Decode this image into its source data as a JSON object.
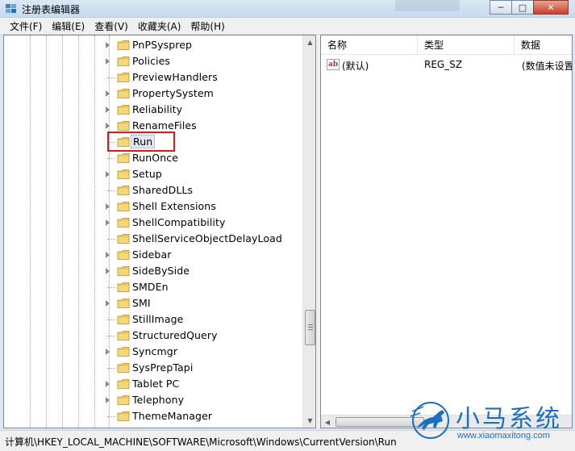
{
  "window": {
    "title": "注册表编辑器",
    "min_label": "─",
    "max_label": "□",
    "close_label": "✕"
  },
  "menu": [
    "文件(F)",
    "编辑(E)",
    "查看(V)",
    "收藏夹(A)",
    "帮助(H)"
  ],
  "tree": {
    "items": [
      {
        "label": "PnPSysprep",
        "expandable": true
      },
      {
        "label": "Policies",
        "expandable": true
      },
      {
        "label": "PreviewHandlers",
        "expandable": false
      },
      {
        "label": "PropertySystem",
        "expandable": true
      },
      {
        "label": "Reliability",
        "expandable": true
      },
      {
        "label": "RenameFiles",
        "expandable": true
      },
      {
        "label": "Run",
        "expandable": false,
        "selected": true
      },
      {
        "label": "RunOnce",
        "expandable": false
      },
      {
        "label": "Setup",
        "expandable": true
      },
      {
        "label": "SharedDLLs",
        "expandable": false
      },
      {
        "label": "Shell Extensions",
        "expandable": true
      },
      {
        "label": "ShellCompatibility",
        "expandable": true
      },
      {
        "label": "ShellServiceObjectDelayLoad",
        "expandable": false
      },
      {
        "label": "Sidebar",
        "expandable": true
      },
      {
        "label": "SideBySide",
        "expandable": true
      },
      {
        "label": "SMDEn",
        "expandable": false
      },
      {
        "label": "SMI",
        "expandable": true
      },
      {
        "label": "StillImage",
        "expandable": false
      },
      {
        "label": "StructuredQuery",
        "expandable": false
      },
      {
        "label": "Syncmgr",
        "expandable": true
      },
      {
        "label": "SysPrepTapi",
        "expandable": false
      },
      {
        "label": "Tablet PC",
        "expandable": true
      },
      {
        "label": "Telephony",
        "expandable": true
      },
      {
        "label": "ThemeManager",
        "expandable": false
      }
    ]
  },
  "list": {
    "columns": [
      "名称",
      "类型",
      "数据"
    ],
    "rows": [
      {
        "name": "(默认)",
        "type": "REG_SZ",
        "data": "(数值未设置"
      }
    ]
  },
  "status": {
    "path": "计算机\\HKEY_LOCAL_MACHINE\\SOFTWARE\\Microsoft\\Windows\\CurrentVersion\\Run"
  },
  "watermark": {
    "title": "小马系统",
    "url": "www.xiaomaxitong.com"
  },
  "colors": {
    "highlight_box": "#d01d1d",
    "folder": "#e8c45a",
    "watermark": "#1b6fc4"
  }
}
